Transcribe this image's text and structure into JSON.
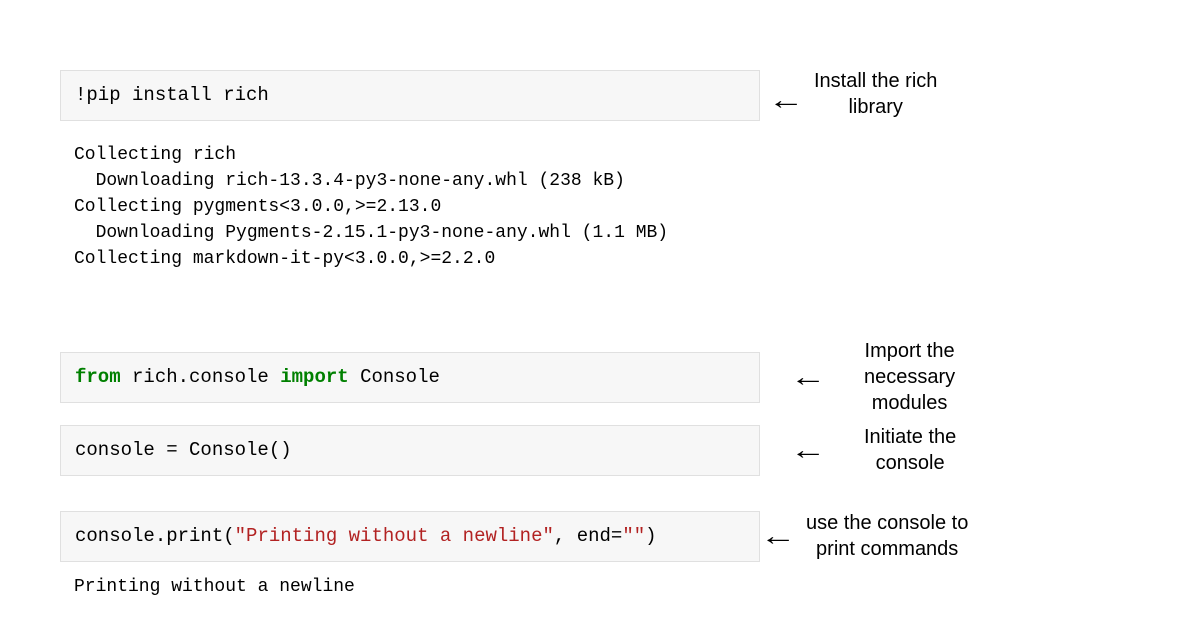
{
  "cells": {
    "install": {
      "code_text": "!pip install rich",
      "annotation": "Install the rich\nlibrary"
    },
    "install_output": "Collecting rich\n  Downloading rich-13.3.4-py3-none-any.whl (238 kB)\nCollecting pygments<3.0.0,>=2.13.0\n  Downloading Pygments-2.15.1-py3-none-any.whl (1.1 MB)\nCollecting markdown-it-py<3.0.0,>=2.2.0",
    "import": {
      "tokens": {
        "from": "from",
        "module": " rich.console ",
        "import": "import",
        "name": " Console"
      },
      "annotation": "Import the\nnecessary\nmodules"
    },
    "initiate": {
      "code_text": "console = Console()",
      "annotation": "Initiate the\nconsole"
    },
    "print": {
      "tokens": {
        "prefix": "console.print(",
        "str": "\"Printing without a newline\"",
        "mid": ", end=",
        "str2": "\"\"",
        "suffix": ")"
      },
      "annotation": "use the console to\nprint commands"
    },
    "print_output": "Printing without a newline"
  }
}
